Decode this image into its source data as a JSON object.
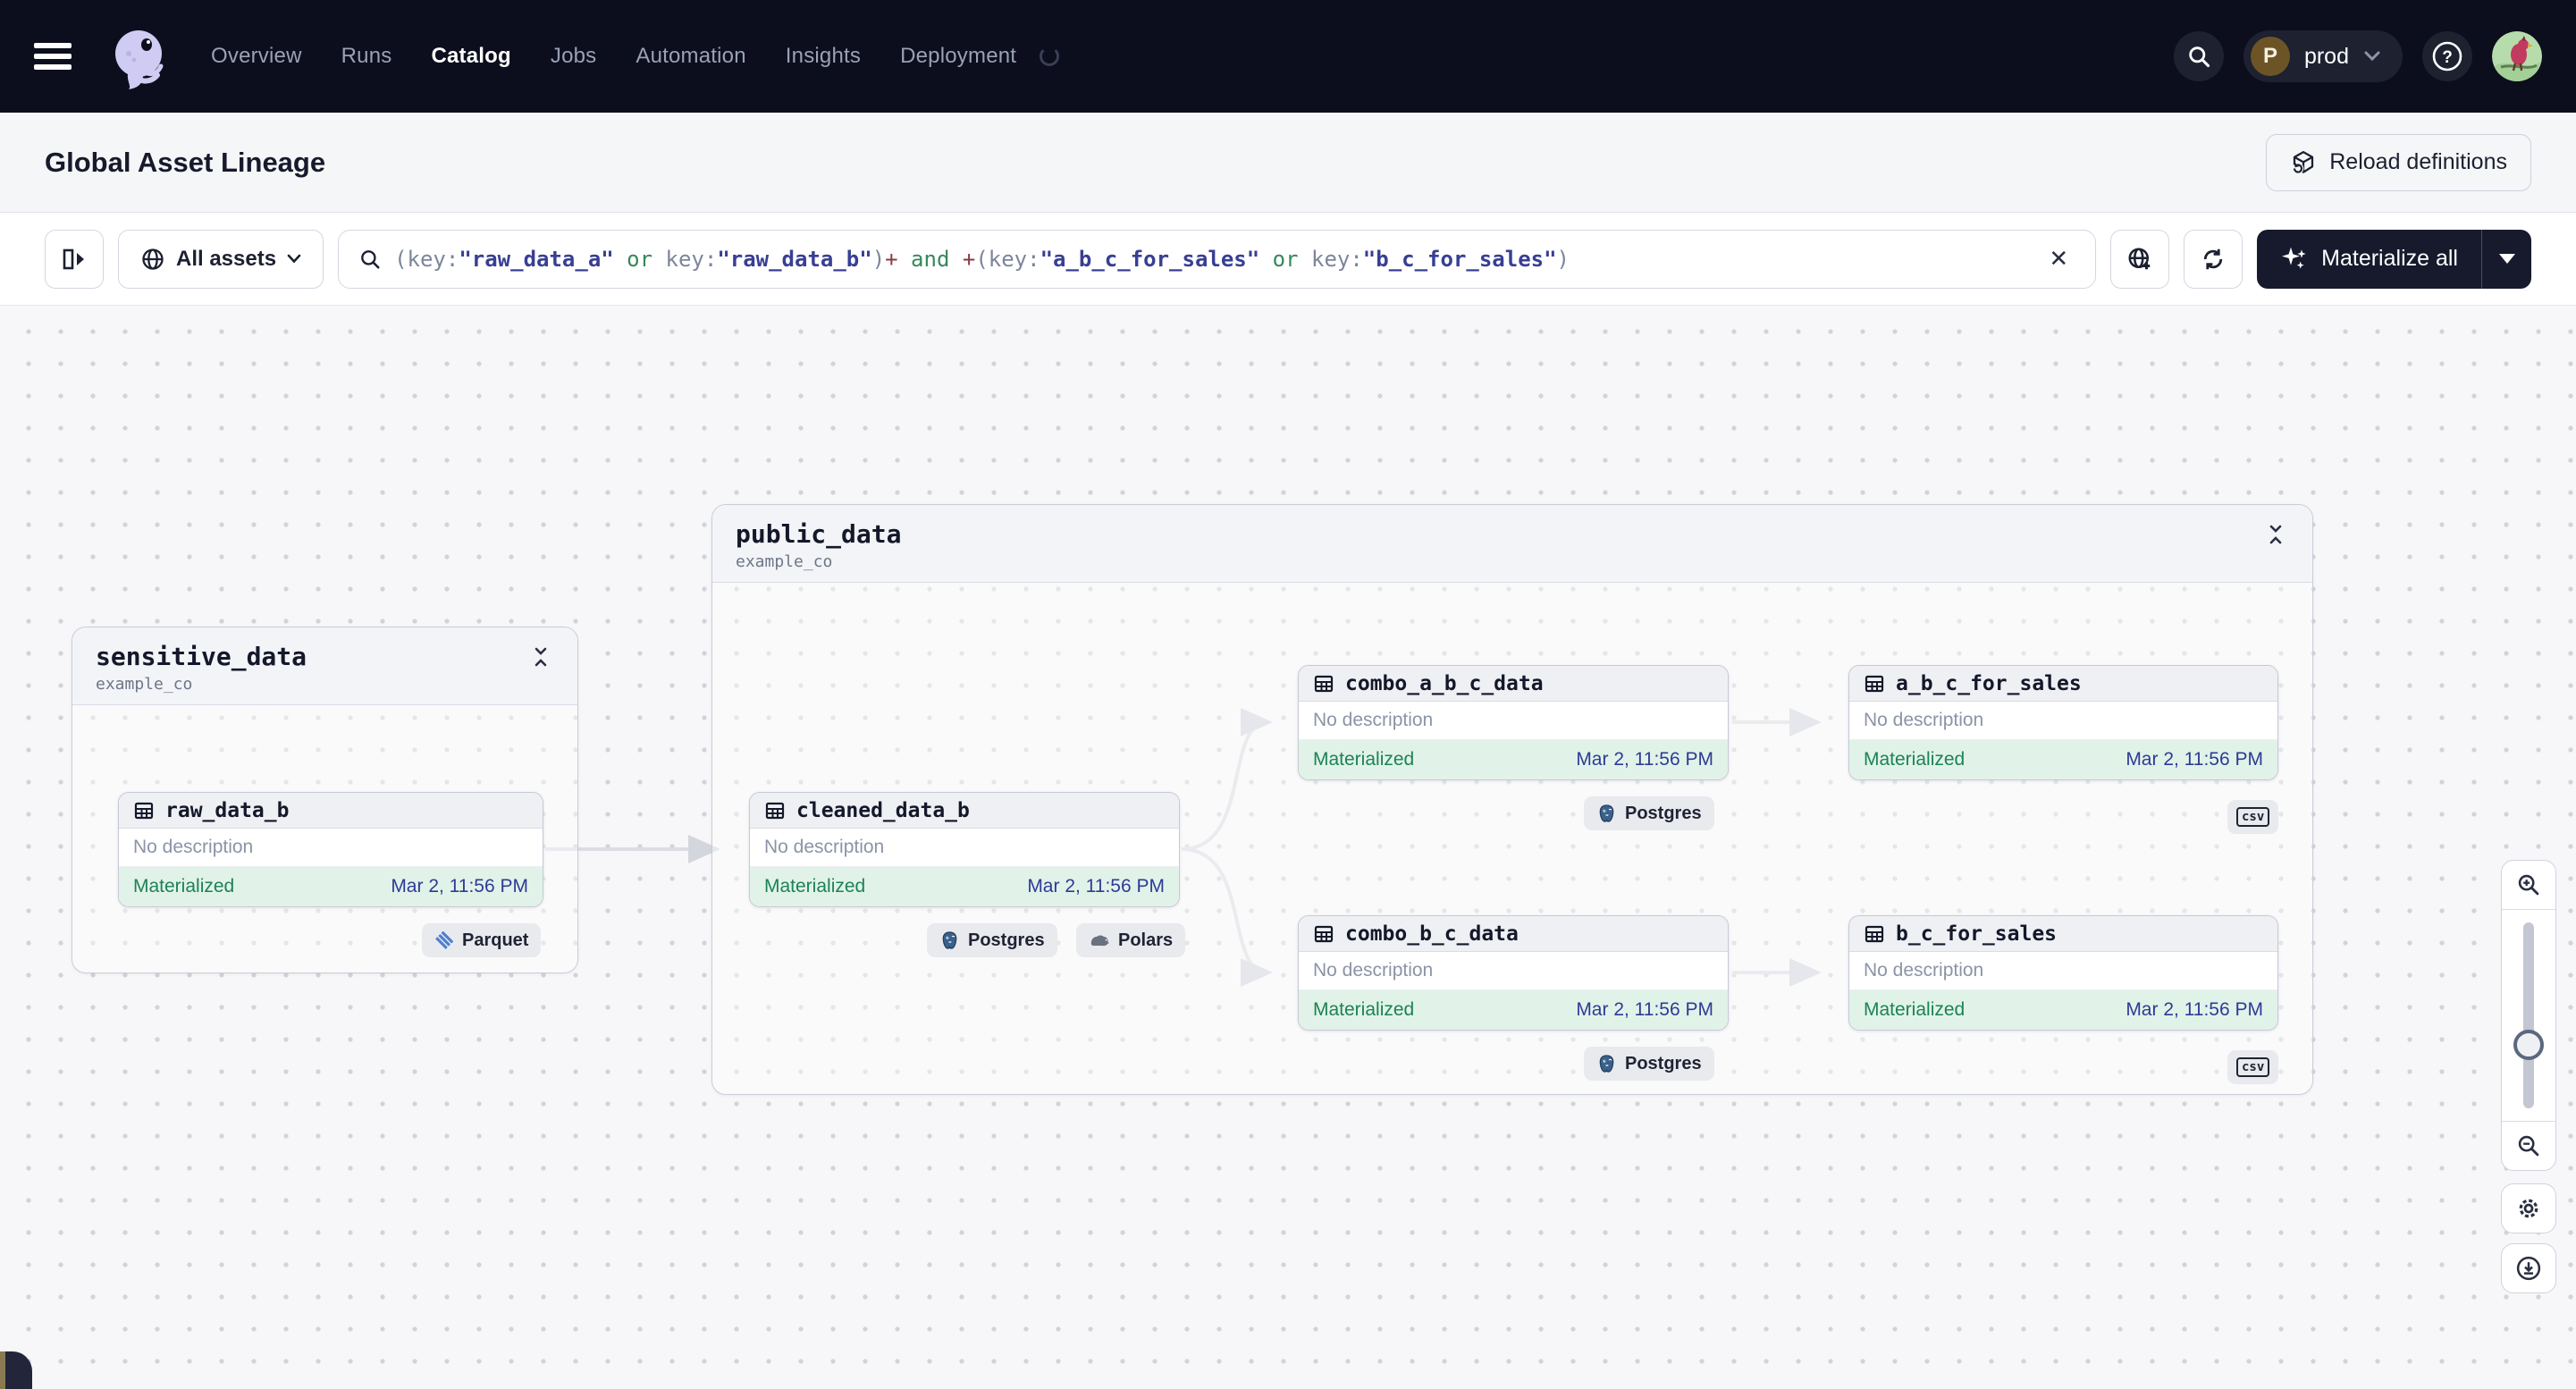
{
  "nav": {
    "items": [
      {
        "label": "Overview"
      },
      {
        "label": "Runs"
      },
      {
        "label": "Catalog"
      },
      {
        "label": "Jobs"
      },
      {
        "label": "Automation"
      },
      {
        "label": "Insights"
      },
      {
        "label": "Deployment"
      }
    ],
    "active_item": "Catalog",
    "env": {
      "initial": "P",
      "name": "prod"
    }
  },
  "header": {
    "title": "Global Asset Lineage",
    "reload_button": "Reload definitions"
  },
  "toolbar": {
    "scope_button": "All assets",
    "materialize_button": "Materialize all",
    "clear_label": "✕",
    "query_segments": [
      {
        "text": "(key:",
        "type": "punct"
      },
      {
        "text": "\"raw_data_a\"",
        "type": "value"
      },
      {
        "text": " or ",
        "type": "op"
      },
      {
        "text": "key:",
        "type": "punct"
      },
      {
        "text": "\"raw_data_b\"",
        "type": "value"
      },
      {
        "text": ")",
        "type": "punct"
      },
      {
        "text": "+",
        "type": "plus"
      },
      {
        "text": " and ",
        "type": "op"
      },
      {
        "text": "+",
        "type": "plus"
      },
      {
        "text": "(key:",
        "type": "punct"
      },
      {
        "text": "\"a_b_c_for_sales\"",
        "type": "value"
      },
      {
        "text": " or ",
        "type": "op"
      },
      {
        "text": "key:",
        "type": "punct"
      },
      {
        "text": "\"b_c_for_sales\"",
        "type": "value"
      },
      {
        "text": ")",
        "type": "punct"
      }
    ]
  },
  "graph": {
    "groups": [
      {
        "name": "sensitive_data",
        "location": "example_co"
      },
      {
        "name": "public_data",
        "location": "example_co"
      }
    ],
    "nodes": [
      {
        "name": "raw_data_b",
        "description": "No description",
        "status": "Materialized",
        "timestamp": "Mar 2, 11:56 PM",
        "tags": [
          {
            "label": "Parquet",
            "icon": "parquet-icon"
          }
        ]
      },
      {
        "name": "cleaned_data_b",
        "description": "No description",
        "status": "Materialized",
        "timestamp": "Mar 2, 11:56 PM",
        "tags": [
          {
            "label": "Postgres",
            "icon": "postgres-icon"
          },
          {
            "label": "Polars",
            "icon": "polars-icon"
          }
        ]
      },
      {
        "name": "combo_a_b_c_data",
        "description": "No description",
        "status": "Materialized",
        "timestamp": "Mar 2, 11:56 PM",
        "tags": [
          {
            "label": "Postgres",
            "icon": "postgres-icon"
          }
        ]
      },
      {
        "name": "a_b_c_for_sales",
        "description": "No description",
        "status": "Materialized",
        "timestamp": "Mar 2, 11:56 PM",
        "tags": [
          {
            "label": "csv",
            "icon": "csv-icon"
          }
        ]
      },
      {
        "name": "combo_b_c_data",
        "description": "No description",
        "status": "Materialized",
        "timestamp": "Mar 2, 11:56 PM",
        "tags": [
          {
            "label": "Postgres",
            "icon": "postgres-icon"
          }
        ]
      },
      {
        "name": "b_c_for_sales",
        "description": "No description",
        "status": "Materialized",
        "timestamp": "Mar 2, 11:56 PM",
        "tags": [
          {
            "label": "csv",
            "icon": "csv-icon"
          }
        ]
      }
    ]
  },
  "colors": {
    "navbar_bg": "#0c0e1d",
    "accent_green": "#1d8254",
    "status_bg": "#e1f3e8",
    "timestamp_blue": "#2f3a96",
    "query_value": "#383f93",
    "query_operator": "#35885c",
    "query_plus": "#8a3a44",
    "edge": "#d8dae1"
  },
  "controls": {
    "icons": [
      "zoom-in",
      "zoom-out",
      "settings",
      "download"
    ]
  }
}
